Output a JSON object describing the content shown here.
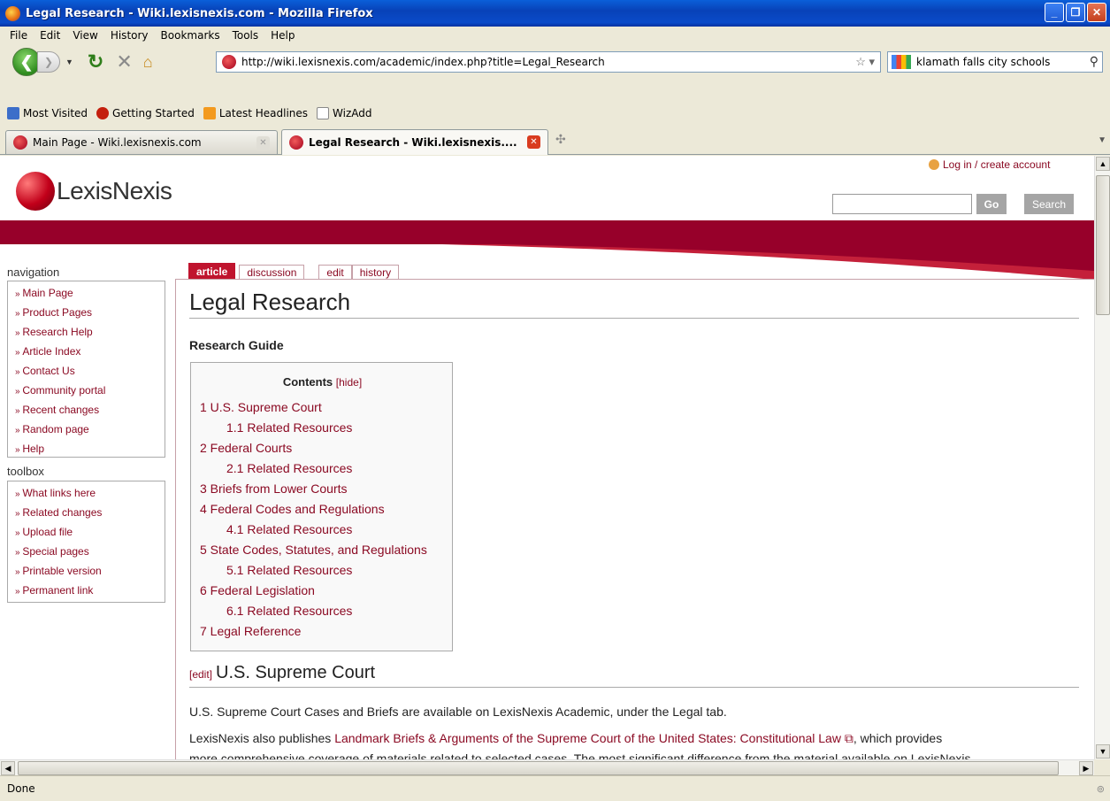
{
  "window": {
    "title": "Legal Research - Wiki.lexisnexis.com - Mozilla Firefox"
  },
  "menu": [
    "File",
    "Edit",
    "View",
    "History",
    "Bookmarks",
    "Tools",
    "Help"
  ],
  "navbar": {
    "url": "http://wiki.lexisnexis.com/academic/index.php?title=Legal_Research",
    "search_engine_text": "klamath falls city schools"
  },
  "bookmarks": [
    "Most Visited",
    "Getting Started",
    "Latest Headlines",
    "WizAdd"
  ],
  "tabs": [
    {
      "label": "Main Page - Wiki.lexisnexis.com"
    },
    {
      "label": "Legal Research - Wiki.lexisnexis...."
    }
  ],
  "status": {
    "text": "Done"
  },
  "page": {
    "logo_text": "LexisNexis",
    "login_link": "Log in / create account",
    "go_button": "Go",
    "search_button": "Search",
    "navigation_title": "navigation",
    "navigation_items": [
      "Main Page",
      "Product Pages",
      "Research Help",
      "Article Index",
      "Contact Us",
      "Community portal",
      "Recent changes",
      "Random page",
      "Help"
    ],
    "toolbox_title": "toolbox",
    "toolbox_items": [
      "What links here",
      "Related changes",
      "Upload file",
      "Special pages",
      "Printable version",
      "Permanent link"
    ],
    "content_tabs": [
      "article",
      "discussion",
      "edit",
      "history"
    ],
    "heading": "Legal Research",
    "subtitle": "Research Guide",
    "toc": {
      "title": "Contents",
      "hide_label": "[hide]",
      "items": [
        {
          "text": "1 U.S. Supreme Court",
          "level": 1
        },
        {
          "text": "1.1 Related Resources",
          "level": 2
        },
        {
          "text": "2 Federal Courts",
          "level": 1
        },
        {
          "text": "2.1 Related Resources",
          "level": 2
        },
        {
          "text": "3 Briefs from Lower Courts",
          "level": 1
        },
        {
          "text": "4 Federal Codes and Regulations",
          "level": 1
        },
        {
          "text": "4.1 Related Resources",
          "level": 2
        },
        {
          "text": "5 State Codes, Statutes, and Regulations",
          "level": 1
        },
        {
          "text": "5.1 Related Resources",
          "level": 2
        },
        {
          "text": "6 Federal Legislation",
          "level": 1
        },
        {
          "text": "6.1 Related Resources",
          "level": 2
        },
        {
          "text": "7 Legal Reference",
          "level": 1
        }
      ]
    },
    "section1": {
      "edit_label": "[edit]",
      "title": "U.S. Supreme Court",
      "para1": "U.S. Supreme Court Cases and Briefs are available on LexisNexis Academic, under the Legal tab.",
      "para2_prefix": "LexisNexis also publishes ",
      "para2_link": "Landmark Briefs & Arguments of the Supreme Court of the United States: Constitutional Law",
      "para2_suffix": ", which provides",
      "para3": "more comprehensive coverage of materials related to selected cases. The most significant difference from the material available on LexisNexis"
    }
  }
}
